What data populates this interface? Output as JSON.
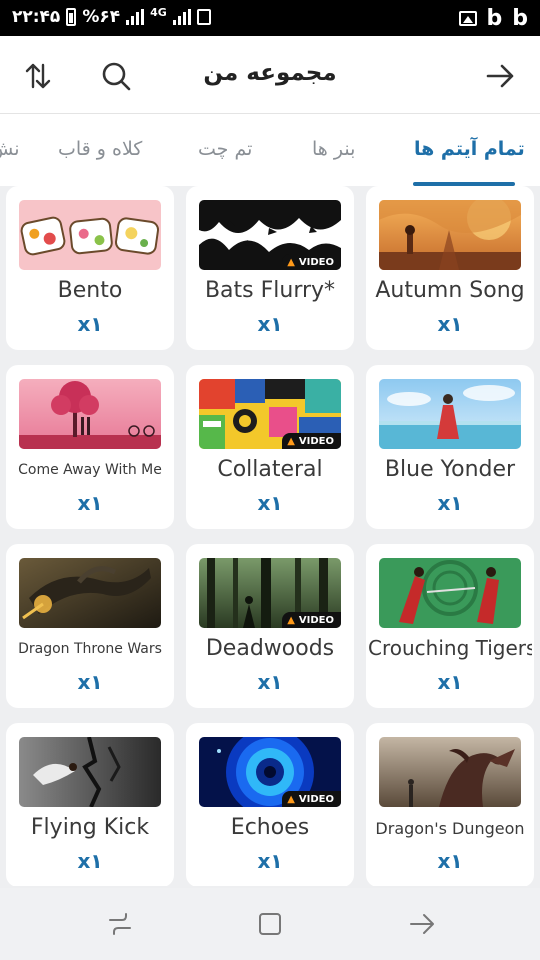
{
  "status_bar": {
    "time": "۲۲:۴۵",
    "battery": "%۶۴",
    "network": "4G",
    "icons": [
      "signal-icon",
      "battery-icon",
      "gallery-icon",
      "b-app-icon",
      "b-app-icon"
    ]
  },
  "header": {
    "title": "مجموعه من",
    "icons": {
      "back": "arrow-right-icon",
      "search": "search-icon",
      "sort": "sort-icon"
    }
  },
  "tabs": [
    {
      "label": "تمام آیتم ها",
      "active": true
    },
    {
      "label": "بنر ها",
      "active": false
    },
    {
      "label": "تم چت",
      "active": false
    },
    {
      "label": "کلاه و قاب",
      "active": false
    },
    {
      "label": "نش",
      "active": false
    }
  ],
  "video_badge": "VIDEO",
  "items": [
    {
      "name": "Autumn Song",
      "count": "x۱",
      "video": false
    },
    {
      "name": "Bats Flurry*",
      "count": "x۱",
      "video": true
    },
    {
      "name": "Bento",
      "count": "x۱",
      "video": false
    },
    {
      "name": "Blue Yonder",
      "count": "x۱",
      "video": false
    },
    {
      "name": "Collateral",
      "count": "x۱",
      "video": true
    },
    {
      "name": "Come Away With Me",
      "count": "x۱",
      "video": false
    },
    {
      "name": "Crouching Tigers",
      "count": "x۱",
      "video": false
    },
    {
      "name": "Deadwoods",
      "count": "x۱",
      "video": true
    },
    {
      "name": "Dragon Throne Wars",
      "count": "x۱",
      "video": false
    },
    {
      "name": "Dragon's Dungeon",
      "count": "x۱",
      "video": false
    },
    {
      "name": "Echoes",
      "count": "x۱",
      "video": true
    },
    {
      "name": "Flying Kick",
      "count": "x۱",
      "video": false
    }
  ],
  "nav": {
    "icons": [
      "back-nav-icon",
      "home-nav-icon",
      "recents-nav-icon"
    ]
  },
  "colors": {
    "accent": "#1e6fa8",
    "background": "#eeeff1",
    "card": "#ffffff"
  }
}
